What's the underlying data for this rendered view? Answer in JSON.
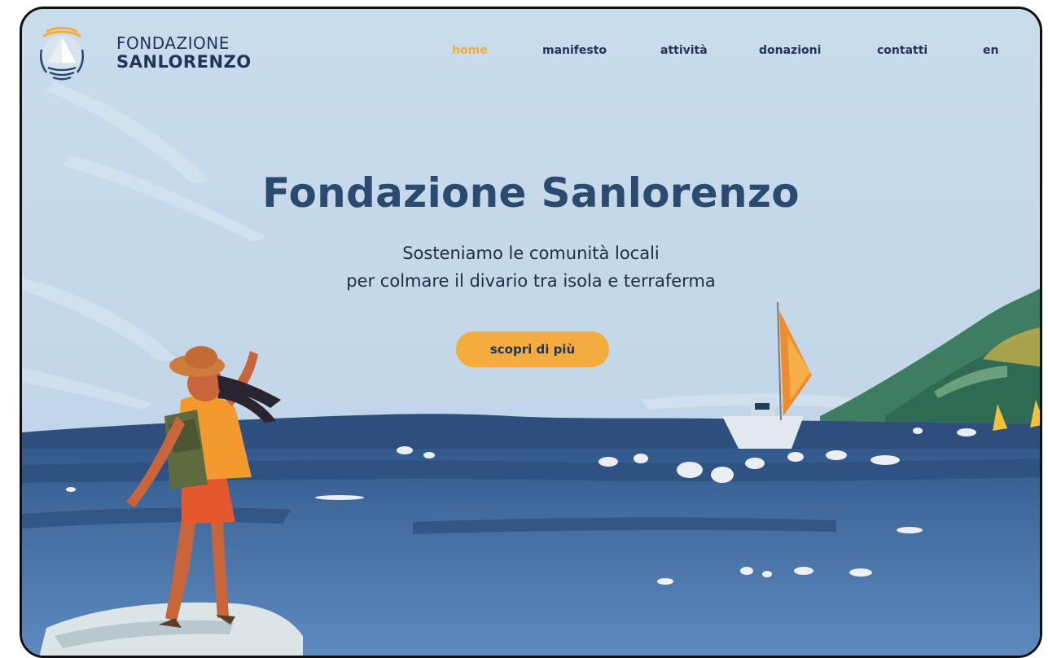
{
  "brand": {
    "name_line1": "FONDAZIONE",
    "name_line2": "SANLORENZO",
    "logo_icon": "sailboat-sun-icon"
  },
  "nav": {
    "items": [
      {
        "label": "home",
        "active": true
      },
      {
        "label": "manifesto",
        "active": false
      },
      {
        "label": "attività",
        "active": false
      },
      {
        "label": "donazioni",
        "active": false
      },
      {
        "label": "contatti",
        "active": false
      },
      {
        "label": "en",
        "active": false
      }
    ]
  },
  "hero": {
    "title": "Fondazione Sanlorenzo",
    "subtitle_line1": "Sosteniamo le comunità locali",
    "subtitle_line2": "per colmare il divario tra isola e terraferma",
    "cta_label": "scopri di più",
    "illustration": "painted-seascape-woman-sailboat"
  },
  "colors": {
    "sky": "#c7daeb",
    "sea": "#3c6496",
    "navy_text": "#1f3557",
    "title_text": "#2b4a70",
    "accent": "#f3ac3d"
  }
}
